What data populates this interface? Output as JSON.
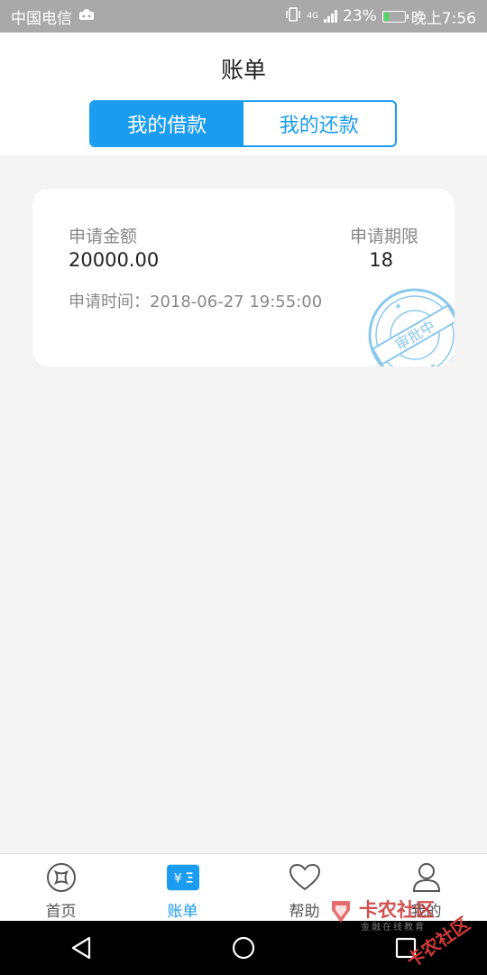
{
  "status_bar": {
    "carrier": "中国电信",
    "battery_percent": "23%",
    "battery_level": 0.23,
    "time": "晚上7:56",
    "signal_label": "4G"
  },
  "header": {
    "title": "账单",
    "tabs": [
      {
        "label": "我的借款",
        "active": true
      },
      {
        "label": "我的还款",
        "active": false
      }
    ]
  },
  "loan_card": {
    "amount_label": "申请金额",
    "amount_value": "20000.00",
    "term_label": "申请期限",
    "term_value": "18",
    "time_label": "申请时间：",
    "time_value": "2018-06-27 19:55:00",
    "stamp_text": "审批中"
  },
  "bottom_nav": {
    "items": [
      {
        "label": "首页",
        "icon": "home-icon",
        "active": false
      },
      {
        "label": "账单",
        "icon": "bill-icon",
        "active": true
      },
      {
        "label": "帮助",
        "icon": "heart-icon",
        "active": false
      },
      {
        "label": "我的",
        "icon": "user-icon",
        "active": false
      }
    ]
  },
  "watermark": {
    "name": "卡农社区",
    "subtitle": "金融在线教育"
  },
  "colors": {
    "accent": "#1a9cf0",
    "background": "#f4f4f4",
    "status_bar": "#a9a9a9",
    "stamp": "#8cc8ec"
  }
}
